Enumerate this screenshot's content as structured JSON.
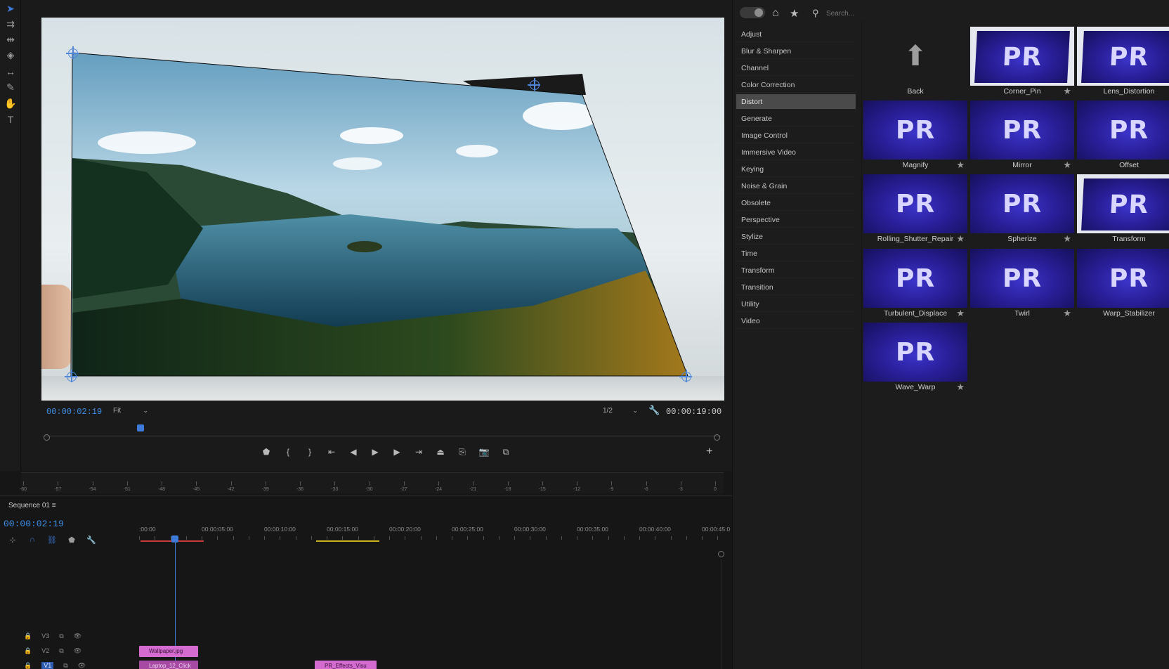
{
  "monitor": {
    "timecode_current": "00:00:02:19",
    "fit": "Fit",
    "resolution": "1/2",
    "timecode_duration": "00:00:19:00"
  },
  "meter_ruler": [
    "-60",
    "-57",
    "-54",
    "-51",
    "-48",
    "-45",
    "-42",
    "-39",
    "-36",
    "-33",
    "-30",
    "-27",
    "-24",
    "-21",
    "-18",
    "-15",
    "-12",
    "-9",
    "-6",
    "-3",
    "0"
  ],
  "timeline": {
    "sequence_name": "Sequence 01",
    "timecode": "00:00:02:19",
    "ruler_labels": [
      ":00:00",
      "00:00:05:00",
      "00:00:10:00",
      "00:00:15:00",
      "00:00:20:00",
      "00:00:25:00",
      "00:00:30:00",
      "00:00:35:00",
      "00:00:40:00",
      "00:00:45:0"
    ],
    "tracks": [
      {
        "name": "V3"
      },
      {
        "name": "V2"
      },
      {
        "name": "V1"
      }
    ],
    "clips": [
      {
        "label": "Wallpaper.jpg"
      },
      {
        "label": "Laptop_12_Click"
      },
      {
        "label": "PR_Effects_Visu"
      }
    ]
  },
  "effects": {
    "search_placeholder": "Search...",
    "categories": [
      "Adjust",
      "Blur & Sharpen",
      "Channel",
      "Color Correction",
      "Distort",
      "Generate",
      "Image Control",
      "Immersive Video",
      "Keying",
      "Noise & Grain",
      "Obsolete",
      "Perspective",
      "Stylize",
      "Time",
      "Transform",
      "Transition",
      "Utility",
      "Video"
    ],
    "selected_category": "Distort",
    "tiles": [
      {
        "label": "Back",
        "kind": "back"
      },
      {
        "label": "Corner_Pin",
        "kind": "framed"
      },
      {
        "label": "Lens_Distortion",
        "kind": "framed"
      },
      {
        "label": "Magnify",
        "kind": "pr"
      },
      {
        "label": "Mirror",
        "kind": "pr"
      },
      {
        "label": "Offset",
        "kind": "pr"
      },
      {
        "label": "Rolling_Shutter_Repair",
        "kind": "pr"
      },
      {
        "label": "Spherize",
        "kind": "pr"
      },
      {
        "label": "Transform",
        "kind": "framed"
      },
      {
        "label": "Turbulent_Displace",
        "kind": "pr"
      },
      {
        "label": "Twirl",
        "kind": "pr"
      },
      {
        "label": "Warp_Stabilizer",
        "kind": "pr"
      },
      {
        "label": "Wave_Warp",
        "kind": "pr"
      }
    ],
    "thumb_text": "PR"
  },
  "colors": {
    "accent_blue": "#3d7ad9",
    "clip_pink": "#d46bd0",
    "thumb_purple": "#2a1f9a"
  }
}
